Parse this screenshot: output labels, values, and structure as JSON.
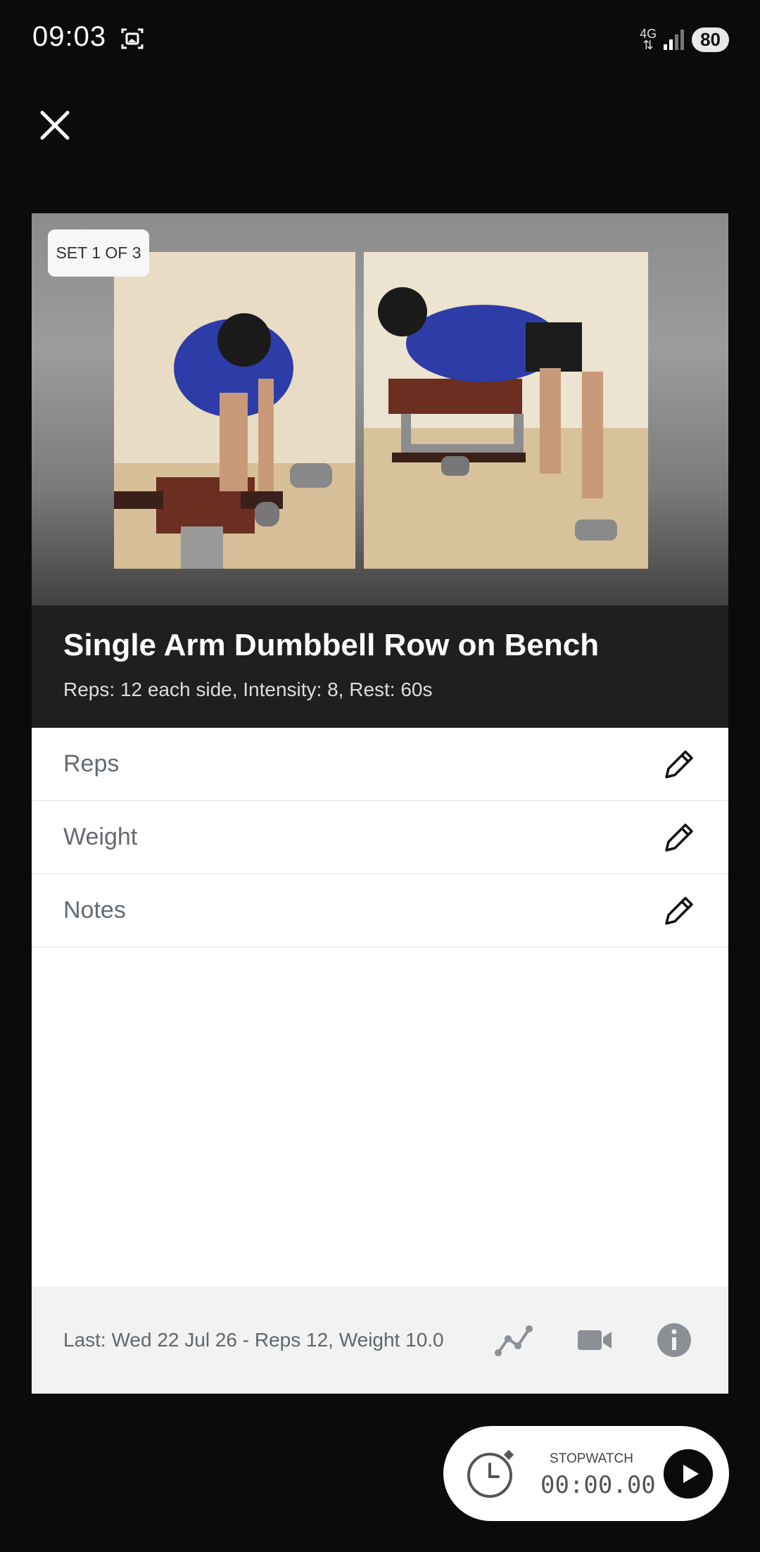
{
  "status": {
    "time": "09:03",
    "network": "4G",
    "battery": "80"
  },
  "exercise": {
    "set_badge": "SET 1 OF 3",
    "title": "Single Arm Dumbbell Row on Bench",
    "subtitle": "Reps: 12 each side, Intensity: 8, Rest: 60s"
  },
  "fields": {
    "reps_label": "Reps",
    "weight_label": "Weight",
    "notes_label": "Notes"
  },
  "footer": {
    "last_text": "Last: Wed 22 Jul 26 - Reps 12, Weight 10.0"
  },
  "stopwatch": {
    "label": "STOPWATCH",
    "time": "00:00.00"
  },
  "icons": {
    "close": "close-icon",
    "edit": "pencil-icon",
    "chart": "line-chart-icon",
    "video": "video-camera-icon",
    "info": "info-icon",
    "clock": "stopwatch-icon",
    "play": "play-icon"
  },
  "colors": {
    "background": "#0b0b0b",
    "title_block": "#1f1f1f",
    "footer": "#f2f2f2",
    "icon_gray": "#8a9096"
  }
}
